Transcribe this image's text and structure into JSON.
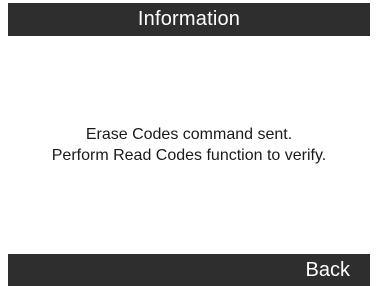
{
  "header": {
    "title": "Information"
  },
  "dialog": {
    "message_lines": [
      "Erase Codes command sent.",
      "Perform Read Codes function to verify."
    ]
  },
  "footer": {
    "back_label": "Back"
  },
  "colors": {
    "bar_background": "#2e2e2e",
    "bar_text": "#ffffff",
    "content_background": "#ffffff",
    "content_text": "#1a1a1a"
  }
}
